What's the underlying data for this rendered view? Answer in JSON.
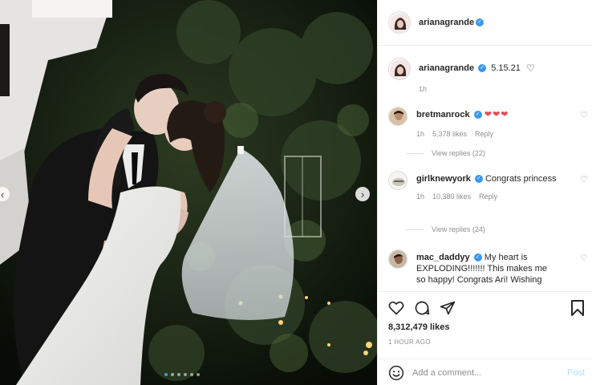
{
  "post": {
    "username": "arianagrande",
    "date": "5.15.21",
    "time_ago": "1h",
    "likes": "8,312,479 likes",
    "posted": "1 HOUR AGO",
    "carousel_count": 6,
    "carousel_active": 1
  },
  "comments": [
    {
      "username": "bretmanrock",
      "text": "",
      "hearts": "❤❤❤",
      "time": "1h",
      "likes": "5,378 likes",
      "reply": "Reply",
      "view_replies": "View replies (22)"
    },
    {
      "username": "girlknewyork",
      "text": "Congrats princess",
      "hearts": "",
      "time": "1h",
      "likes": "10,380 likes",
      "reply": "Reply",
      "view_replies": "View replies (24)"
    },
    {
      "username": "mac_daddyy",
      "text": "My heart is EXPLODING!!!!!!! This makes me so happy! Congrats Ari! Wishing",
      "hearts": "",
      "time": "",
      "likes": "",
      "reply": "",
      "view_replies": ""
    }
  ],
  "composer": {
    "placeholder": "Add a comment...",
    "post_label": "Post"
  },
  "colors": {
    "verified": "#3897f0",
    "heart": "#ed4956",
    "post_disabled": "#b2dffc"
  },
  "icons": [
    "chevron-left-icon",
    "chevron-right-icon",
    "heart-icon",
    "comment-icon",
    "share-icon",
    "bookmark-icon",
    "emoji-icon",
    "verified-icon"
  ]
}
